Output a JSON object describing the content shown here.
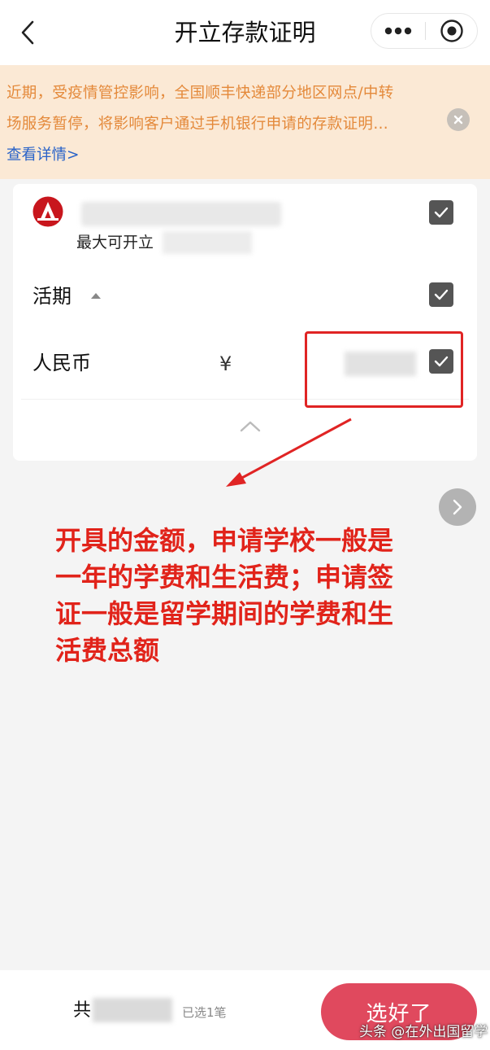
{
  "navbar": {
    "title": "开立存款证明",
    "back_icon": "chevron-left-icon",
    "more_icon": "more-dots-icon",
    "close_icon": "target-circle-icon"
  },
  "notice": {
    "lines": [
      "近期，受疫情管控影响，全国顺丰快递部分地区网点/中转",
      "场服务暂停，将影响客户通过手机银行申请的存款证明…"
    ],
    "link": "查看详情>",
    "close_icon": "close-icon"
  },
  "account": {
    "max_label": "最大可开立",
    "bank_logo": "bank-logo-icon"
  },
  "section": {
    "label": "活期",
    "caret_icon": "caret-up-icon"
  },
  "currency_row": {
    "label": "人民币",
    "symbol": "¥"
  },
  "annotation": {
    "lines": [
      "开具的金额，申请学校一般是",
      "一年的学费和生活费；申请签",
      "证一般是留学期间的学费和生",
      "活费总额"
    ],
    "color": "#e1231a"
  },
  "bottom": {
    "total_label": "共",
    "selected_count": "已选1笔",
    "done_label": "选好了"
  },
  "watermark": "头条 @在外出国留学",
  "colors": {
    "notice_bg": "#fbe9d5",
    "notice_text": "#e4893a",
    "link": "#2a63c8",
    "checkbox": "#555555",
    "primary_button": "#e0495e"
  }
}
